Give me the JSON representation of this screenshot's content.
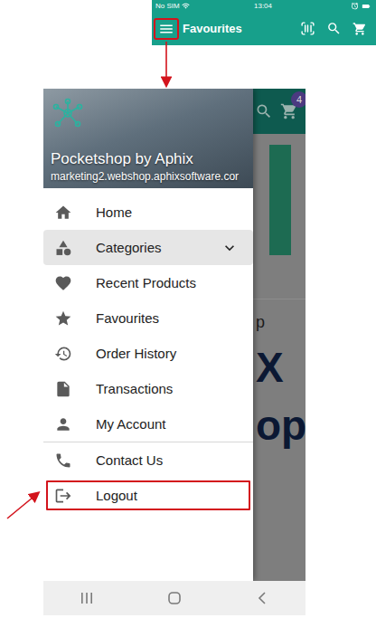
{
  "app_screen": {
    "status_bar": {
      "carrier": "No SIM",
      "time": "13:04"
    },
    "app_bar": {
      "title": "Favourites",
      "menu_annotated": true
    }
  },
  "drawer": {
    "header": {
      "title": "Pocketshop by Aphix",
      "subtitle": "marketing2.webshop.aphixsoftware.cor"
    },
    "groups": [
      [
        {
          "label": "Home",
          "selected": false,
          "expandable": false,
          "expanded": false,
          "annotated": false
        },
        {
          "label": "Categories",
          "selected": true,
          "expandable": true,
          "expanded": false,
          "annotated": false
        },
        {
          "label": "Recent Products",
          "selected": false,
          "expandable": false,
          "expanded": false,
          "annotated": false
        },
        {
          "label": "Favourites",
          "selected": false,
          "expandable": false,
          "expanded": false,
          "annotated": false
        },
        {
          "label": "Order History",
          "selected": false,
          "expandable": false,
          "expanded": false,
          "annotated": false
        },
        {
          "label": "Transactions",
          "selected": false,
          "expandable": false,
          "expanded": false,
          "annotated": false
        },
        {
          "label": "My Account",
          "selected": false,
          "expandable": false,
          "expanded": false,
          "annotated": false
        }
      ],
      [
        {
          "label": "Contact Us",
          "selected": false,
          "expandable": false,
          "expanded": false,
          "annotated": false
        },
        {
          "label": "Logout",
          "selected": false,
          "expandable": false,
          "expanded": false,
          "annotated": true
        }
      ]
    ]
  },
  "background": {
    "cart_badge": "4",
    "texts": [
      {
        "text": "p",
        "kind": "caption"
      },
      {
        "text": "X",
        "kind": "logo"
      },
      {
        "text": "op",
        "kind": "logo"
      }
    ]
  }
}
